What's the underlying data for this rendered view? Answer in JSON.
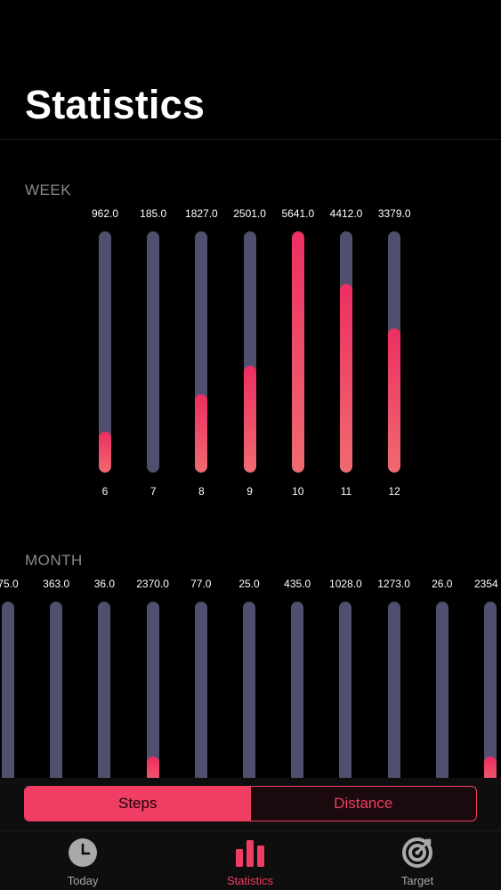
{
  "header": {
    "title": "Statistics"
  },
  "week": {
    "label": "WEEK",
    "max": 5641,
    "bars": [
      {
        "value": "962.0",
        "day": "6",
        "v": 962
      },
      {
        "value": "185.0",
        "day": "7",
        "v": 185
      },
      {
        "value": "1827.0",
        "day": "8",
        "v": 1827
      },
      {
        "value": "2501.0",
        "day": "9",
        "v": 2501
      },
      {
        "value": "5641.0",
        "day": "10",
        "v": 5641
      },
      {
        "value": "4412.0",
        "day": "11",
        "v": 4412
      },
      {
        "value": "3379.0",
        "day": "12",
        "v": 3379
      }
    ]
  },
  "month": {
    "label": "MONTH",
    "bars": [
      {
        "value": "75.0",
        "fill": 0
      },
      {
        "value": "363.0",
        "fill": 0
      },
      {
        "value": "36.0",
        "fill": 0
      },
      {
        "value": "2370.0",
        "fill": 0.19
      },
      {
        "value": "77.0",
        "fill": 0
      },
      {
        "value": "25.0",
        "fill": 0
      },
      {
        "value": "435.0",
        "fill": 0
      },
      {
        "value": "1028.0",
        "fill": 0
      },
      {
        "value": "1273.0",
        "fill": 0
      },
      {
        "value": "26.0",
        "fill": 0
      },
      {
        "value": "2354",
        "fill": 0.19
      }
    ]
  },
  "segments": {
    "steps": "Steps",
    "distance": "Distance"
  },
  "tabs": [
    {
      "label": "Today",
      "icon": "clock-icon",
      "active": false
    },
    {
      "label": "Statistics",
      "icon": "bar-chart-icon",
      "active": true
    },
    {
      "label": "Target",
      "icon": "target-icon",
      "active": false
    }
  ],
  "colors": {
    "accent": "#ef3d63",
    "track": "#4f4f6e",
    "background": "#000000"
  }
}
